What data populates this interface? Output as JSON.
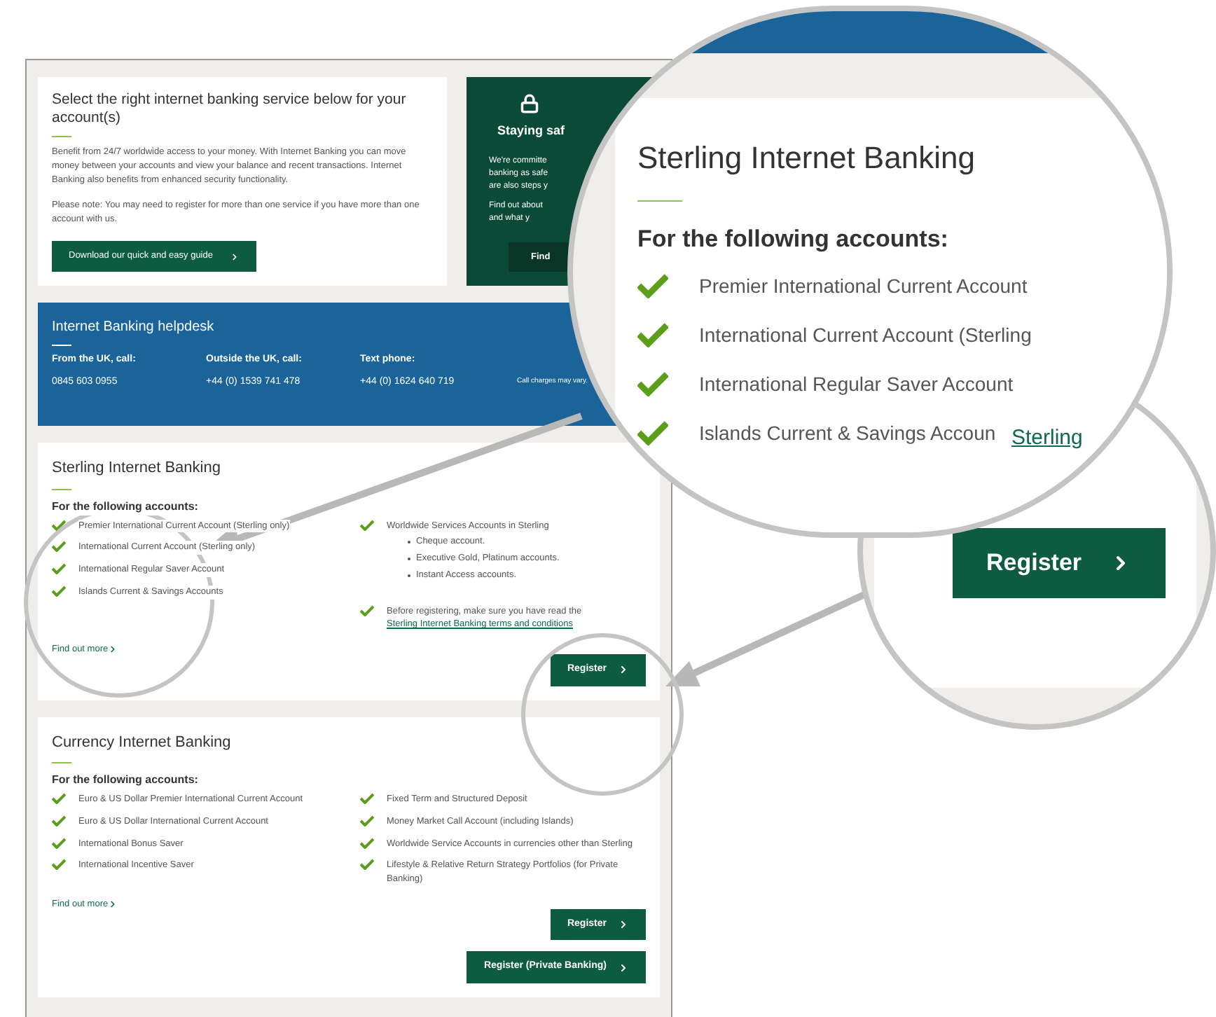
{
  "intro": {
    "title": "Select the right internet banking service below for your account(s)",
    "body": "Benefit from 24/7 worldwide access to your money. With Internet Banking you can move money between your accounts and view your balance and recent transactions. Internet Banking also benefits from enhanced security functionality.",
    "note": "Please note: You may need to register for more than one service if you have more than one account with us.",
    "button": "Download our quick and easy guide"
  },
  "safety_panel": {
    "title": "Staying saf",
    "lines": [
      "We're committe",
      "banking as safe",
      "are also steps y"
    ],
    "lines_2": [
      "Find out about",
      "and what y"
    ],
    "button": "Find"
  },
  "helpdesk": {
    "title": "Internet Banking helpdesk",
    "contacts": [
      {
        "label": "From the UK, call:",
        "number": "0845 603 0955"
      },
      {
        "label": "Outside the UK, call:",
        "number": "+44 (0) 1539 741 478"
      },
      {
        "label": "Text phone:",
        "number": "+44 (0) 1624 640 719"
      }
    ],
    "note": "Call charges may vary."
  },
  "sections": [
    {
      "title": "Sterling Internet Banking",
      "subtitle": "For the following accounts:",
      "left_items": [
        "Premier International Current Account (Sterling only)",
        "International Current Account (Sterling only)",
        "International Regular Saver Account",
        "Islands Current & Savings Accounts"
      ],
      "right_items": [
        {
          "text": "Worldwide Services Accounts in Sterling",
          "sub_items": [
            "Cheque account.",
            "Executive Gold, Platinum accounts.",
            "Instant Access accounts."
          ]
        }
      ],
      "notice": {
        "text": "Before registering, make sure you have read the",
        "link": "Sterling Internet Banking terms and conditions"
      },
      "find_more": "Find out more",
      "buttons": [
        "Register"
      ]
    },
    {
      "title": "Currency Internet Banking",
      "subtitle": "For the following accounts:",
      "left_items": [
        "Euro & US Dollar Premier International Current Account",
        "Euro & US Dollar International Current Account",
        "International Bonus Saver",
        "International Incentive Saver"
      ],
      "right_items": [
        {
          "text": "Fixed Term and Structured Deposit"
        },
        {
          "text": "Money Market Call Account (including Islands)"
        },
        {
          "text": "Worldwide Service Accounts in currencies other than Sterling"
        },
        {
          "text": "Lifestyle & Relative Return Strategy Portfolios (for Private Banking)"
        }
      ],
      "find_more": "Find out more",
      "buttons": [
        "Register",
        "Register (Private Banking)"
      ]
    }
  ],
  "magnifier_main": {
    "title": "Sterling Internet Banking",
    "subtitle": "For the following accounts:",
    "items": [
      "Premier International Current Account",
      "International Current Account (Sterling",
      "International Regular Saver Account",
      "Islands Current & Savings Accoun"
    ]
  },
  "magnifier_button": {
    "link": "Sterling",
    "button": "Register"
  }
}
